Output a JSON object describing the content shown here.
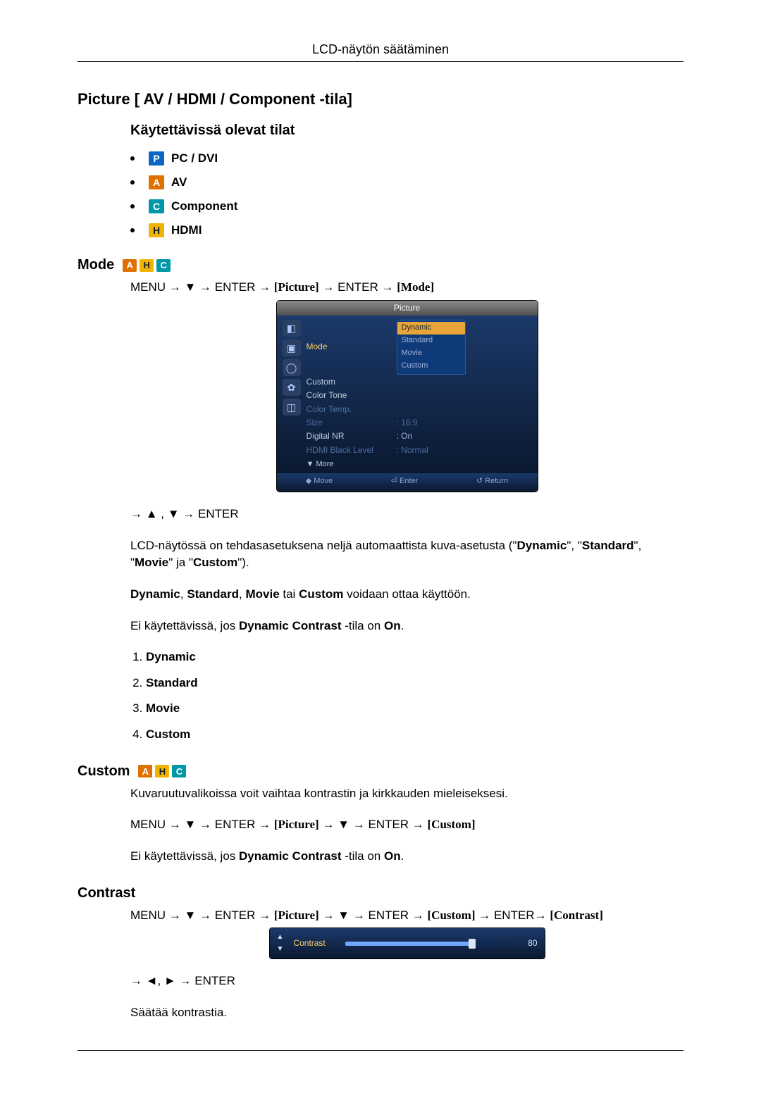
{
  "header": "LCD-näytön säätäminen",
  "section_title": "Picture [ AV / HDMI / Component -tila]",
  "available_title": "Käytettävissä olevat tilat",
  "modes": {
    "p_letter": "P",
    "p_label": "PC / DVI",
    "a_letter": "A",
    "a_label": "AV",
    "c_letter": "C",
    "c_label": "Component",
    "h_letter": "H",
    "h_label": "HDMI"
  },
  "mode": {
    "heading": "Mode",
    "strip": {
      "a": "A",
      "h": "H",
      "c": "C"
    },
    "path_prefix": "MENU → ▼ → ENTER → ",
    "path_b1": "[Picture]",
    "path_mid": " → ENTER → ",
    "path_b2": "[Mode]",
    "nav2": "→ ▲ , ▼ → ENTER",
    "osd": {
      "title": "Picture",
      "rows": {
        "mode": "Mode",
        "custom": "Custom",
        "colortone": "Color Tone",
        "colortemp": "Color Temp.",
        "size": "Size",
        "size_val": ": 16:9",
        "dnr": "Digital NR",
        "dnr_val": ": On",
        "hbl": "HDMI Black Level",
        "hbl_val": ": Normal",
        "more": "▼ More"
      },
      "popup": {
        "dynamic": "Dynamic",
        "standard": "Standard",
        "movie": "Movie",
        "custom": "Custom"
      },
      "foot": {
        "move": "◆ Move",
        "enter": "⏎ Enter",
        "return": "↺ Return"
      }
    },
    "p1a": "LCD-näytössä on tehdasasetuksena neljä automaattista kuva-asetusta (\"",
    "p1b": "Dynamic",
    "p1c": "\", \"",
    "p1d": "Standard",
    "p1e": "\", \"",
    "p1f": "Movie",
    "p1g": "\" ja \"",
    "p1h": "Custom",
    "p1i": "\").",
    "p2a": "Dynamic",
    "p2b": ", ",
    "p2c": "Standard",
    "p2d": ", ",
    "p2e": "Movie",
    "p2f": " tai ",
    "p2g": "Custom",
    "p2h": " voidaan ottaa käyttöön.",
    "p3a": "Ei käytettävissä, jos ",
    "p3b": "Dynamic Contrast",
    "p3c": " -tila on ",
    "p3d": "On",
    "p3e": ".",
    "list": {
      "i1": "Dynamic",
      "i2": "Standard",
      "i3": "Movie",
      "i4": "Custom"
    }
  },
  "custom": {
    "heading": "Custom",
    "intro": "Kuvaruutuvalikoissa voit vaihtaa kontrastin ja kirkkauden mieleiseksesi.",
    "path_prefix": "MENU → ▼ → ENTER → ",
    "path_b1": "[Picture]",
    "path_mid": " → ▼ → ENTER → ",
    "path_b2": "[Custom]",
    "p3a": "Ei käytettävissä, jos ",
    "p3b": "Dynamic Contrast",
    "p3c": " -tila on ",
    "p3d": "On",
    "p3e": "."
  },
  "contrast": {
    "heading": "Contrast",
    "path_prefix": "MENU → ▼ → ENTER → ",
    "path_b1": "[Picture]",
    "path_mid1": " → ▼ → ENTER → ",
    "path_b2": "[Custom]",
    "path_mid2": " → ENTER→ ",
    "path_b3": "[Contrast]",
    "osd": {
      "label": "Contrast",
      "value": "80",
      "up": "▲",
      "down": "▼"
    },
    "nav2": "→ ◄, ► → ENTER",
    "desc": "Säätää kontrastia."
  }
}
